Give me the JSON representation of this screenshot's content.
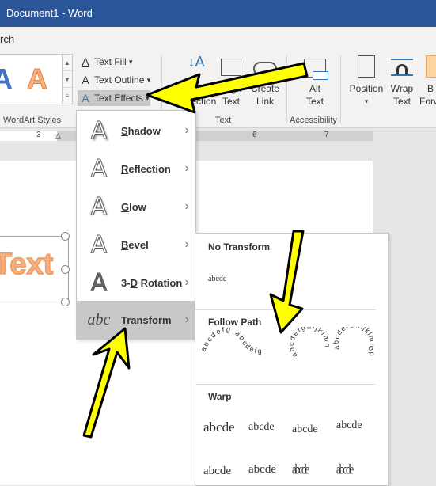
{
  "window": {
    "title": "Document1  -  Word"
  },
  "search": {
    "partial_text": "rch"
  },
  "ribbon": {
    "wordart": {
      "group_label": "WordArt Styles",
      "text_fill": "Text Fill",
      "text_outline": "Text Outline",
      "text_effects": "Text Effects",
      "dropdown_glyph": "▾",
      "gallery_colors": [
        "#4472c4",
        "#f4b183"
      ]
    },
    "text_group": {
      "label": "Text",
      "text_direction": [
        "Text",
        "Direction"
      ],
      "align_text": [
        "Align",
        "Text"
      ],
      "create_link": [
        "Create",
        "Link"
      ]
    },
    "accessibility_group": {
      "label": "Accessibility",
      "alt_text": [
        "Alt",
        "Text"
      ]
    },
    "arrange_group": {
      "position": "Position",
      "wrap_text": [
        "Wrap",
        "Text"
      ],
      "bring_forward": [
        "B",
        "Forw"
      ]
    }
  },
  "ruler": {
    "labels": [
      "3",
      "6",
      "7"
    ]
  },
  "document": {
    "wordart_text": "Text"
  },
  "text_effects_menu": {
    "items": [
      {
        "pre": "",
        "u": "S",
        "post": "hadow",
        "icon": "shadow-icon"
      },
      {
        "pre": "",
        "u": "R",
        "post": "eflection",
        "icon": "reflection-icon"
      },
      {
        "pre": "",
        "u": "G",
        "post": "low",
        "icon": "glow-icon"
      },
      {
        "pre": "",
        "u": "B",
        "post": "evel",
        "icon": "bevel-icon"
      },
      {
        "pre": "3-",
        "u": "D",
        "post": " Rotation",
        "icon": "3d-rotation-icon"
      },
      {
        "pre": "",
        "u": "T",
        "post": "ransform",
        "icon": "transform-icon",
        "selected": true
      }
    ],
    "chevron": "›",
    "icon_glyph": "A",
    "transform_glyph": "abc"
  },
  "transform_submenu": {
    "no_transform": {
      "heading": "No Transform",
      "sample": "abcde"
    },
    "follow_path": {
      "heading": "Follow Path",
      "samples": [
        "abcdefg abcdefg",
        "abcdefghijklmn",
        "abcdefGhijklmnop"
      ]
    },
    "warp": {
      "heading": "Warp",
      "samples": [
        "abcde",
        "abcde",
        "abcde",
        "abcde",
        "abcde",
        "abcde",
        "abcde",
        "abcde"
      ]
    }
  },
  "annotations": {
    "arrow_color": "#ffff00"
  }
}
